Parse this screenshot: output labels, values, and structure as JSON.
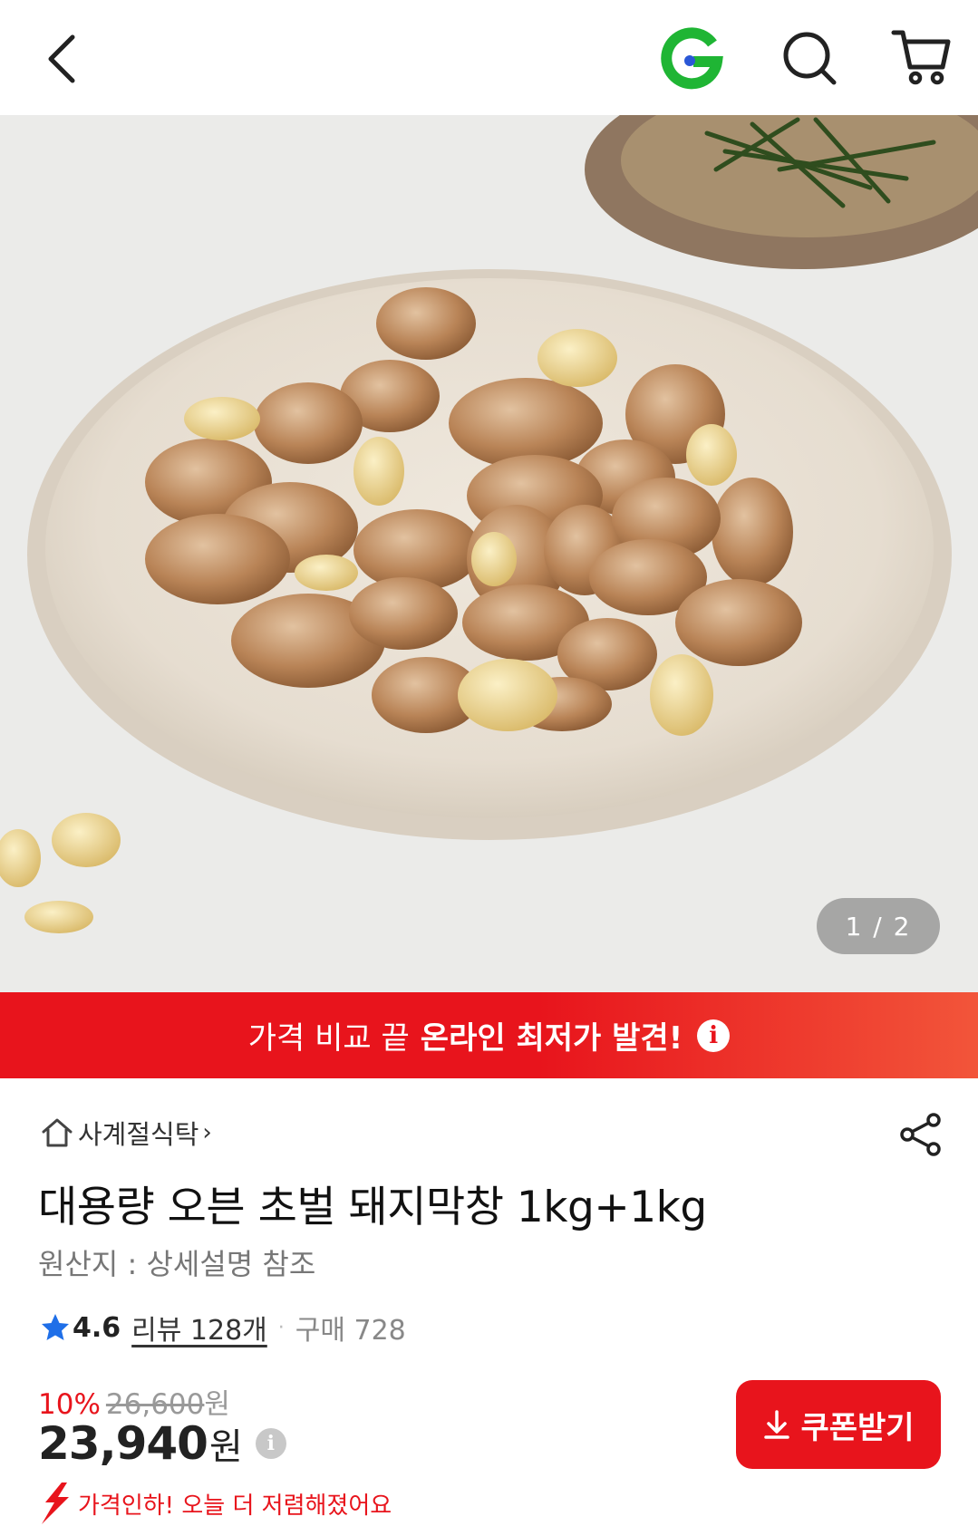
{
  "header": {
    "back_icon": "chevron-left-icon",
    "logo_icon": "g-logo-icon",
    "logo_colors": {
      "green": "#1fb534",
      "blue": "#2a57d6"
    },
    "search_icon": "search-icon",
    "cart_icon": "cart-icon"
  },
  "gallery": {
    "indicator": "1 / 2"
  },
  "banner": {
    "text_light": "가격 비교 끝",
    "text_bold": "온라인 최저가 발견!",
    "info_icon": "info-icon",
    "color": "#e8141c"
  },
  "product": {
    "store_name": "사계절식탁",
    "store_chevron": "›",
    "title": "대용량 오븐 초벌 돼지막창 1kg+1kg",
    "origin": "원산지 : 상세설명 참조",
    "rating": "4.6",
    "review_label": "리뷰 128개",
    "separator": "·",
    "purchase_label": "구매 728",
    "discount_percent": "10%",
    "original_price": "26,600",
    "original_currency": "원",
    "price": "23,940",
    "currency": "원",
    "price_drop_text": "가격인하! 오늘 더 저렴해졌어요",
    "coupon_button": "쿠폰받기"
  },
  "colors": {
    "accent_red": "#e8141c",
    "star_blue": "#1f6fe8"
  }
}
